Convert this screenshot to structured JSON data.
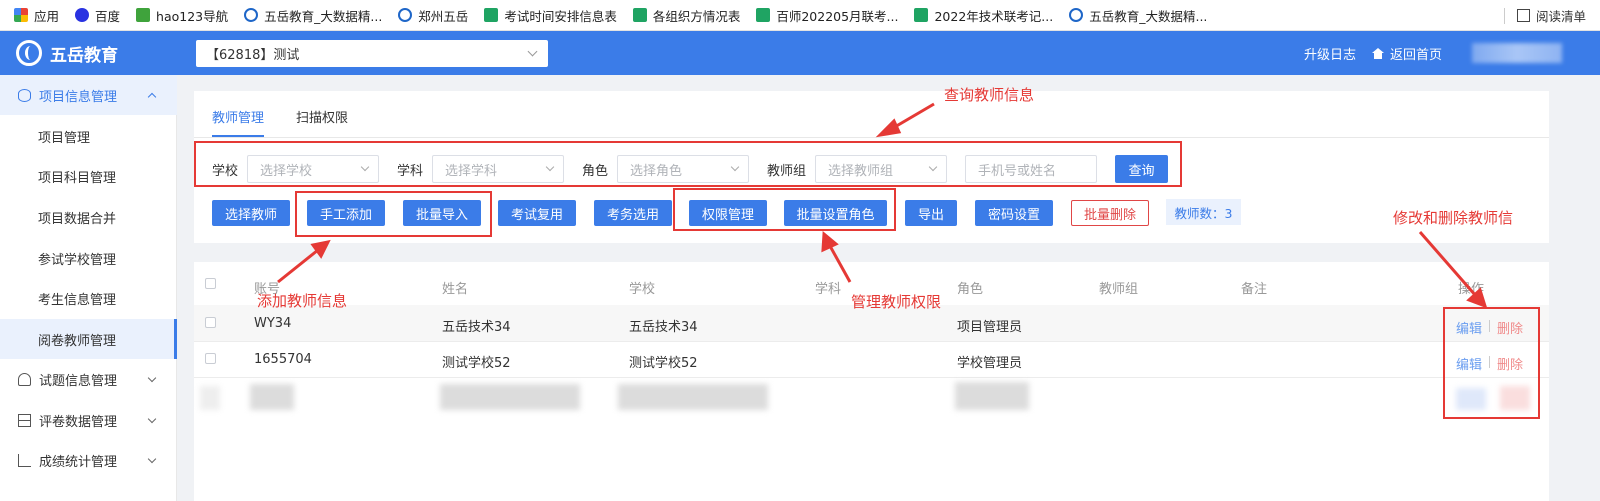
{
  "bookmarks": [
    {
      "icon": "apps-grid-icon",
      "label": "应用"
    },
    {
      "icon": "baidu-paw-icon",
      "label": "百度"
    },
    {
      "icon": "hao123-icon",
      "label": "hao123导航"
    },
    {
      "icon": "wuyue-logo-icon",
      "label": "五岳教育_大数据精..."
    },
    {
      "icon": "wuyue-logo-icon",
      "label": "郑州五岳"
    },
    {
      "icon": "sheet-icon",
      "label": "考试时间安排信息表"
    },
    {
      "icon": "sheet-icon",
      "label": "各组织方情况表"
    },
    {
      "icon": "sheet-icon",
      "label": "百师202205月联考..."
    },
    {
      "icon": "sheet-icon",
      "label": "2022年技术联考记..."
    },
    {
      "icon": "wuyue-logo-icon",
      "label": "五岳教育_大数据精..."
    }
  ],
  "reading_list": "阅读清单",
  "header": {
    "brand": "五岳教育",
    "project_select": "【62818】测试",
    "upgrade_log": "升级日志",
    "back_home": "返回首页"
  },
  "sidebar": {
    "group_open": "项目信息管理",
    "sub_items": [
      "项目管理",
      "项目科目管理",
      "项目数据合并",
      "参试学校管理",
      "考生信息管理",
      "阅卷教师管理"
    ],
    "groups": [
      "试题信息管理",
      "评卷数据管理",
      "成绩统计管理"
    ]
  },
  "tabs": [
    "教师管理",
    "扫描权限"
  ],
  "filters": {
    "school_label": "学校",
    "school_placeholder": "选择学校",
    "subject_label": "学科",
    "subject_placeholder": "选择学科",
    "role_label": "角色",
    "role_placeholder": "选择角色",
    "group_label": "教师组",
    "group_placeholder": "选择教师组",
    "search_placeholder": "手机号或姓名",
    "query": "查询"
  },
  "actions": {
    "select_teacher": "选择教师",
    "manual_add": "手工添加",
    "batch_import": "批量导入",
    "exam_reuse": "考试复用",
    "affairs_select": "考务选用",
    "permission": "权限管理",
    "batch_role": "批量设置角色",
    "export": "导出",
    "password": "密码设置",
    "batch_delete": "批量删除",
    "count": "教师数：3"
  },
  "table": {
    "columns": [
      "账号",
      "姓名",
      "学校",
      "学科",
      "角色",
      "教师组",
      "备注",
      "操作"
    ],
    "rows": [
      {
        "account": "WY34",
        "name": "五岳技术34",
        "school": "五岳技术34",
        "subject": "",
        "role": "项目管理员",
        "group": "",
        "note": ""
      },
      {
        "account": "1655704",
        "name": "测试学校52",
        "school": "测试学校52",
        "subject": "",
        "role": "学校管理员",
        "group": "",
        "note": ""
      }
    ],
    "edit": "编辑",
    "delete": "删除"
  },
  "annotations": {
    "query_info": "查询教师信息",
    "add_info": "添加教师信息",
    "manage_perm": "管理教师权限",
    "edit_delete": "修改和删除教师信"
  },
  "colors": {
    "primary": "#3b7ce8",
    "annotation": "#e53935",
    "danger": "#e04646"
  }
}
